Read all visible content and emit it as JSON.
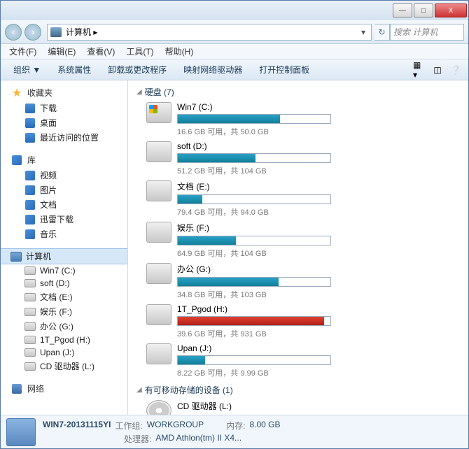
{
  "titlebar": {
    "min": "—",
    "max": "□",
    "close": "X"
  },
  "nav": {
    "back": "‹",
    "fwd": "›",
    "location": "计算机 ▸",
    "refresh": "↻",
    "search_placeholder": "搜索 计算机"
  },
  "menu": {
    "file": "文件(F)",
    "edit": "编辑(E)",
    "view": "查看(V)",
    "tools": "工具(T)",
    "help": "帮助(H)"
  },
  "toolbar": {
    "org": "组织 ▼",
    "props": "系统属性",
    "uninstall": "卸载或更改程序",
    "mapdrive": "映射网络驱动器",
    "ctrlpanel": "打开控制面板"
  },
  "sidebar": {
    "fav": {
      "hdr": "收藏夹",
      "items": [
        "下载",
        "桌面",
        "最近访问的位置"
      ]
    },
    "lib": {
      "hdr": "库",
      "items": [
        "视频",
        "图片",
        "文档",
        "迅雷下载",
        "音乐"
      ]
    },
    "comp": {
      "hdr": "计算机",
      "items": [
        "Win7 (C:)",
        "soft (D:)",
        "文档 (E:)",
        "娱乐 (F:)",
        "办公 (G:)",
        "1T_Pgod (H:)",
        "Upan (J:)",
        "CD 驱动器 (L:)"
      ]
    },
    "net": {
      "hdr": "网络"
    }
  },
  "content": {
    "hdd_hdr": "硬盘 (7)",
    "drives": [
      {
        "name": "Win7 (C:)",
        "info": "16.6 GB 可用，共 50.0 GB",
        "pct": 67,
        "win": true
      },
      {
        "name": "soft (D:)",
        "info": "51.2 GB 可用，共 104 GB",
        "pct": 51
      },
      {
        "name": "文档 (E:)",
        "info": "79.4 GB 可用，共 94.0 GB",
        "pct": 16
      },
      {
        "name": "娱乐 (F:)",
        "info": "64.9 GB 可用，共 104 GB",
        "pct": 38
      },
      {
        "name": "办公 (G:)",
        "info": "34.8 GB 可用，共 103 GB",
        "pct": 66
      },
      {
        "name": "1T_Pgod (H:)",
        "info": "39.6 GB 可用，共 931 GB",
        "pct": 96,
        "red": true
      },
      {
        "name": "Upan (J:)",
        "info": "8.22 GB 可用，共 9.99 GB",
        "pct": 18
      }
    ],
    "removable_hdr": "有可移动存储的设备 (1)",
    "cd": "CD 驱动器 (L:)"
  },
  "status": {
    "name": "WIN7-20131115YI",
    "wg_label": "工作组:",
    "wg": "WORKGROUP",
    "mem_label": "内存:",
    "mem": "8.00 GB",
    "cpu_label": "处理器:",
    "cpu": "AMD Athlon(tm) II X4..."
  }
}
